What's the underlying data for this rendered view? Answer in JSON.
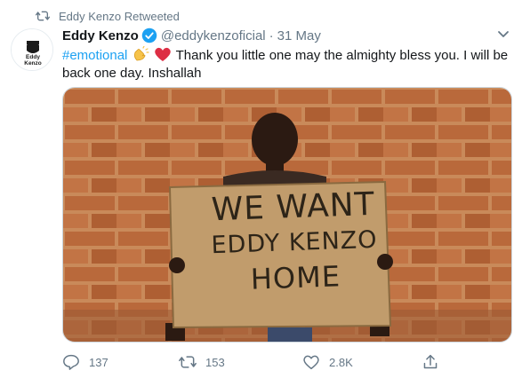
{
  "retweet_banner": {
    "label": "Eddy Kenzo Retweeted",
    "icon": "retweet-icon"
  },
  "tweet": {
    "author_name": "Eddy Kenzo",
    "verified": true,
    "handle": "@eddykenzoficial",
    "separator": "·",
    "date": "31 May",
    "hashtag": "#emotional",
    "emojis": [
      "clapping-hands-emoji",
      "red-heart-emoji"
    ],
    "text": "Thank you little one may the almighty bless you. I will be back one day. Inshallah",
    "avatar_text": "Eddy Kenzo"
  },
  "media": {
    "sign_lines": [
      "WE WANT",
      "EDDY KENZO",
      "HOME"
    ],
    "small_marks": [
      "Share",
      "Share",
      "Share",
      "Share",
      "Share",
      "Share"
    ]
  },
  "actions": {
    "replies": "137",
    "retweets": "153",
    "likes": "2.8K"
  },
  "colors": {
    "accent": "#1da1f2",
    "secondary_text": "#657786",
    "primary_text": "#14171a",
    "like_heart": "#e0245e"
  }
}
